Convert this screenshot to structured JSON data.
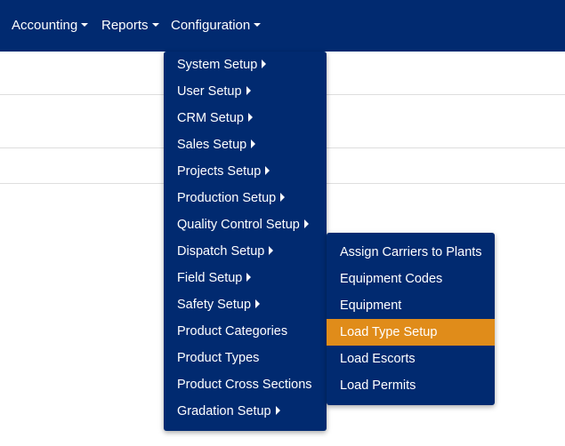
{
  "navbar": {
    "items": [
      {
        "label": "Accounting"
      },
      {
        "label": "Reports"
      },
      {
        "label": "Configuration"
      }
    ]
  },
  "config_menu": {
    "items": [
      {
        "label": "System Setup",
        "has_submenu": true
      },
      {
        "label": "User Setup",
        "has_submenu": true
      },
      {
        "label": "CRM Setup",
        "has_submenu": true
      },
      {
        "label": "Sales Setup",
        "has_submenu": true
      },
      {
        "label": "Projects Setup",
        "has_submenu": true
      },
      {
        "label": "Production Setup",
        "has_submenu": true
      },
      {
        "label": "Quality Control Setup",
        "has_submenu": true
      },
      {
        "label": "Dispatch Setup",
        "has_submenu": true
      },
      {
        "label": "Field Setup",
        "has_submenu": true
      },
      {
        "label": "Safety Setup",
        "has_submenu": true
      },
      {
        "label": "Product Categories",
        "has_submenu": false
      },
      {
        "label": "Product Types",
        "has_submenu": false
      },
      {
        "label": "Product Cross Sections",
        "has_submenu": false
      },
      {
        "label": "Gradation Setup",
        "has_submenu": true
      }
    ]
  },
  "dispatch_submenu": {
    "items": [
      {
        "label": "Assign Carriers to Plants"
      },
      {
        "label": "Equipment Codes"
      },
      {
        "label": "Equipment"
      },
      {
        "label": "Load Type Setup",
        "highlighted": true
      },
      {
        "label": "Load Escorts"
      },
      {
        "label": "Load Permits"
      }
    ]
  },
  "colors": {
    "navbar_bg": "#012a70",
    "menu_bg": "#012a70",
    "highlight": "#e08c1a",
    "text": "#ffffff"
  }
}
